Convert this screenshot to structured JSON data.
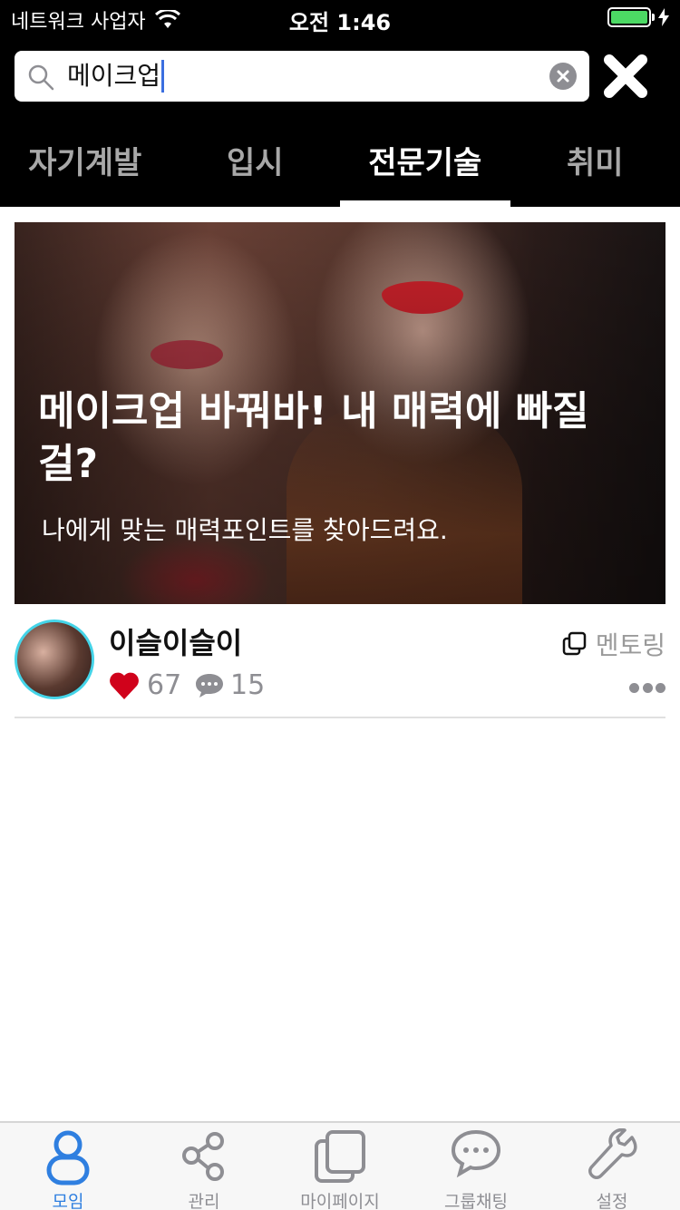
{
  "status_bar": {
    "carrier": "네트워크 사업자",
    "time": "오전 1:46",
    "battery_percent": 100
  },
  "search": {
    "value": "메이크업",
    "icon": "search-icon"
  },
  "tabs": [
    {
      "label": "자기계발",
      "active": false
    },
    {
      "label": "입시",
      "active": false
    },
    {
      "label": "전문기술",
      "active": true
    },
    {
      "label": "취미",
      "active": false
    }
  ],
  "post": {
    "title": "메이크업 바꿔바! 내 매력에 빠질걸?",
    "subtitle": "나에게 맞는 매력포인트를 찾아드려요.",
    "author": "이슬이슬이",
    "likes": "67",
    "comments": "15",
    "type_label": "멘토링"
  },
  "tabbar": [
    {
      "label": "모임",
      "icon": "person-icon",
      "active": true
    },
    {
      "label": "관리",
      "icon": "share-icon",
      "active": false
    },
    {
      "label": "마이페이지",
      "icon": "square-icon",
      "active": false
    },
    {
      "label": "그룹채팅",
      "icon": "chat-icon",
      "active": false
    },
    {
      "label": "설정",
      "icon": "wrench-icon",
      "active": false
    }
  ],
  "colors": {
    "accent": "#2f7fe0",
    "like": "#d0021b",
    "header_bg": "#000000",
    "avatar_ring": "#44d4e8"
  }
}
